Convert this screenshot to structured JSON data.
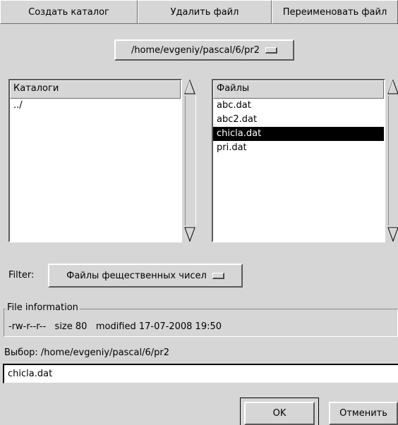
{
  "toolbar": {
    "create_dir": "Создать каталог",
    "delete_file": "Удалить файл",
    "rename_file": "Переименовать файл"
  },
  "path_menu": {
    "value": "/home/evgeniy/pascal/6/pr2"
  },
  "directories": {
    "header": "Каталоги",
    "items": [
      "../"
    ]
  },
  "files": {
    "header": "Файлы",
    "items": [
      "abc.dat",
      "abc2.dat",
      "chicla.dat",
      "pri.dat"
    ],
    "selected": "chicla.dat"
  },
  "filter": {
    "label": "Filter:",
    "value": "Файлы фещественных чисел"
  },
  "file_info": {
    "legend": "File information",
    "text": "-rw-r--r--   size 80   modified 17-07-2008 19:50"
  },
  "selection": {
    "label": "Выбор: /home/evgeniy/pascal/6/pr2",
    "value": "chicla.dat"
  },
  "buttons": {
    "ok": "OK",
    "cancel": "Отменить"
  }
}
